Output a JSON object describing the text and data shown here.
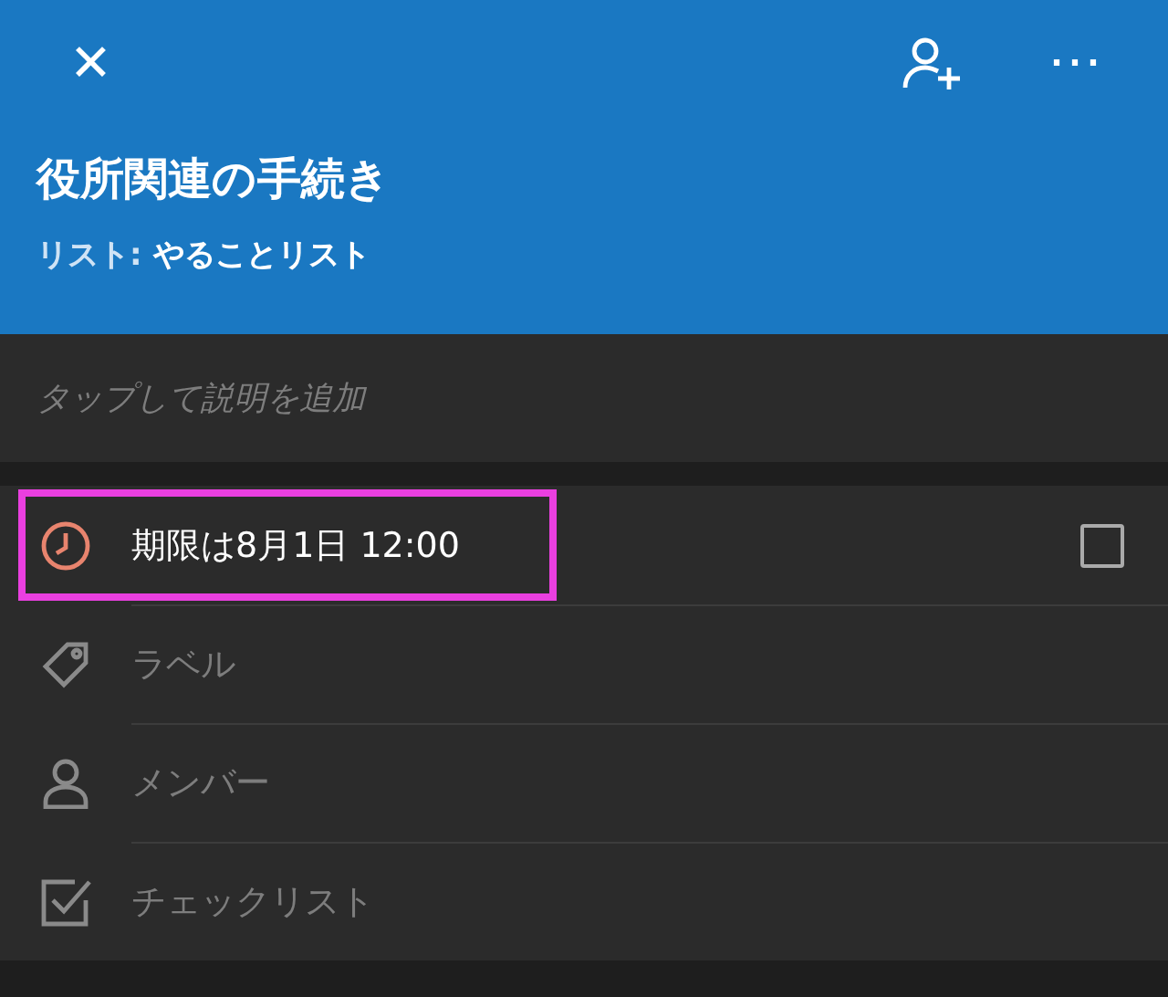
{
  "header": {
    "close_icon": "✕",
    "more_icon": "⋯",
    "title": "役所関連の手続き",
    "list_label": "リスト:",
    "list_name": "やることリスト"
  },
  "description": {
    "placeholder": "タップして説明を追加"
  },
  "rows": [
    {
      "kind": "due",
      "text": "期限は8月1日 12:00",
      "filled": true,
      "highlighted": true,
      "checked": false
    },
    {
      "kind": "label",
      "text": "ラベル",
      "filled": false,
      "highlighted": false
    },
    {
      "kind": "members",
      "text": "メンバー",
      "filled": false,
      "highlighted": false
    },
    {
      "kind": "checklist",
      "text": "チェックリスト",
      "filled": false,
      "highlighted": false
    }
  ]
}
